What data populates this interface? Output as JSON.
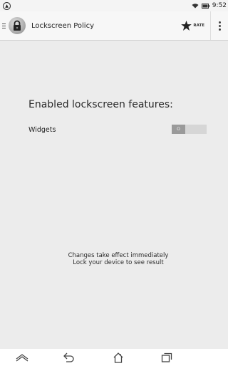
{
  "status_bar": {
    "time": "9:52",
    "icons": [
      "notification-icon",
      "wifi-icon",
      "battery-icon"
    ]
  },
  "app_bar": {
    "title": "Lockscreen Policy",
    "rate_label": "RATE",
    "icons": [
      "drawer-icon",
      "lock-app-icon",
      "star-icon",
      "overflow-menu-icon"
    ]
  },
  "main": {
    "section_title": "Enabled lockscreen features:",
    "settings": [
      {
        "label": "Widgets",
        "toggle_state": "O"
      }
    ],
    "info_lines": [
      "Changes take effect immediately",
      "Lock your device to see result"
    ]
  },
  "nav_bar": {
    "icons": [
      "navbar-collapse-icon",
      "back-icon",
      "home-icon",
      "recents-icon"
    ]
  }
}
